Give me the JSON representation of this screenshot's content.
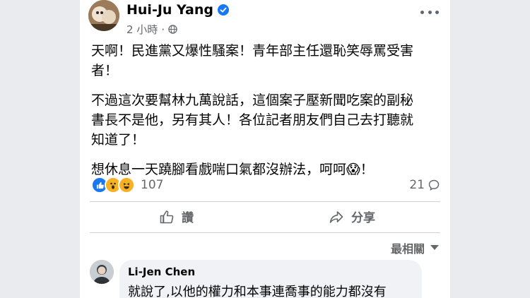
{
  "post": {
    "author": "Hui-Ju Yang",
    "time": "2 小時",
    "paragraphs": [
      "天啊！民進黨又爆性騷案！青年部主任還恥笑辱罵受害者！",
      "不過這次要幫林九萬說話，這個案子壓新聞吃案的副秘書長不是他，另有其人！各位記者朋友們自己去打聽就知道了！",
      "想休息一天蹺腳看戲喘口氣都沒辦法，呵呵😱！"
    ],
    "reaction_count": "107",
    "comment_count": "21"
  },
  "actions": {
    "like": "讚",
    "share": "分享"
  },
  "comments": {
    "sort_label": "最相關",
    "first": {
      "name": "Li-Jen Chen",
      "text": "就說了,以他的權力和本事連喬事的能力都沒有"
    }
  },
  "colors": {
    "accent": "#1877f2",
    "muted": "#65676b",
    "bubble": "#f0f2f5"
  },
  "icons": [
    "verified-badge-icon",
    "globe-icon",
    "more-options-icon",
    "like-reaction-icon",
    "wow-reaction-icon",
    "haha-reaction-icon",
    "comment-icon",
    "like-icon",
    "share-icon",
    "dropdown-arrow-icon"
  ]
}
